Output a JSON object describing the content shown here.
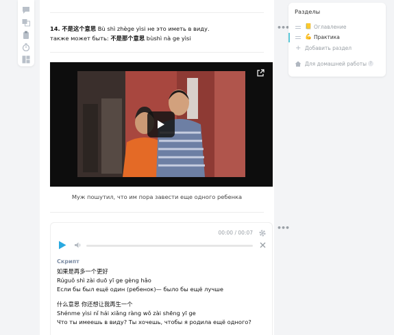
{
  "rail": {
    "icons": [
      "comment-icon",
      "translate-icon",
      "clipboard-icon",
      "timer-icon",
      "layout-icon"
    ]
  },
  "item14": {
    "number": "14.",
    "phrase_hanzi": "不是这个意思",
    "phrase_pinyin": "Bù shì zhège yìsi",
    "phrase_translation": "не это иметь в виду.",
    "alt_prefix": "также может быть:",
    "alt_hanzi": "不是那个意思",
    "alt_pinyin": "bùshì nà ge yìsi"
  },
  "video": {
    "caption": "Муж пошутил, что им пора завести еще одного ребенка",
    "play_icon": "play-icon",
    "expand_icon": "expand-icon"
  },
  "audio": {
    "time": "00:00 / 00:07",
    "progress": 0,
    "script_label": "Скрипт",
    "lines": [
      "如果是再多一个更好",
      "Rúguǒ shì zài duō yī ge gèng hǎo",
      "Если бы был ещё один   (ребенок)— было бы ещё лучше",
      "",
      "什么意思 你还想让我再生一个",
      "Shénme yìsi nǐ hái xiǎng ràng wǒ zài shēng yī ge",
      "Что ты имеешь в виду? Ты хочешь, чтобы я родила ещё одного?"
    ]
  },
  "sections": {
    "title": "Разделы",
    "items": [
      {
        "emoji": "📒",
        "label": "Оглавление"
      },
      {
        "emoji": "💪",
        "label": "Практика"
      }
    ],
    "add_label": "Добавить раздел",
    "home_label": "Для домашней работы",
    "help_symbol": "?"
  },
  "colors": {
    "accent": "#2aa9e0",
    "active_marker": "#5ac8d8",
    "muted_text": "#9aa0a6"
  }
}
